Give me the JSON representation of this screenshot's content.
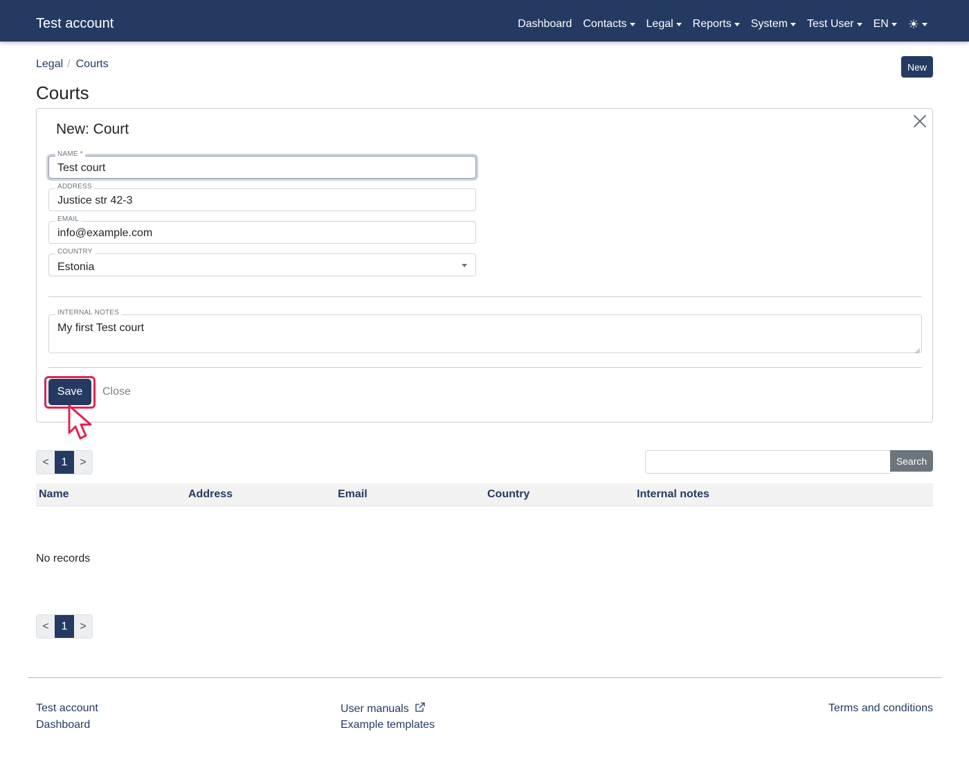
{
  "navbar": {
    "brand": "Test account",
    "items": [
      {
        "label": "Dashboard",
        "dropdown": false
      },
      {
        "label": "Contacts",
        "dropdown": true
      },
      {
        "label": "Legal",
        "dropdown": true
      },
      {
        "label": "Reports",
        "dropdown": true
      },
      {
        "label": "System",
        "dropdown": true
      },
      {
        "label": "Test User",
        "dropdown": true
      },
      {
        "label": "EN",
        "dropdown": true
      }
    ],
    "theme_icon": "sun-icon"
  },
  "breadcrumb": {
    "items": [
      "Legal",
      "Courts"
    ]
  },
  "header": {
    "new_label": "New",
    "title": "Courts"
  },
  "form": {
    "title": "New: Court",
    "fields": {
      "name": {
        "label": "NAME *",
        "value": "Test court"
      },
      "address": {
        "label": "ADDRESS",
        "value": "Justice str 42-3"
      },
      "email": {
        "label": "EMAIL",
        "value": "info@example.com"
      },
      "country": {
        "label": "COUNTRY",
        "value": "Estonia"
      },
      "notes": {
        "label": "INTERNAL NOTES",
        "value": "My first Test court"
      }
    },
    "save_label": "Save",
    "close_label": "Close"
  },
  "pagination": {
    "prev": "<",
    "current": "1",
    "next": ">"
  },
  "search": {
    "button_label": "Search",
    "placeholder": ""
  },
  "table": {
    "columns": [
      "Name",
      "Address",
      "Email",
      "Country",
      "Internal notes"
    ],
    "empty_text": "No records"
  },
  "footer": {
    "left": [
      "Test account",
      "Dashboard"
    ],
    "middle": [
      "User manuals",
      "Example templates"
    ],
    "right": [
      "Terms and conditions"
    ]
  },
  "colors": {
    "primary": "#243a62",
    "highlight": "#e0234f",
    "secondary": "#6c757d"
  }
}
